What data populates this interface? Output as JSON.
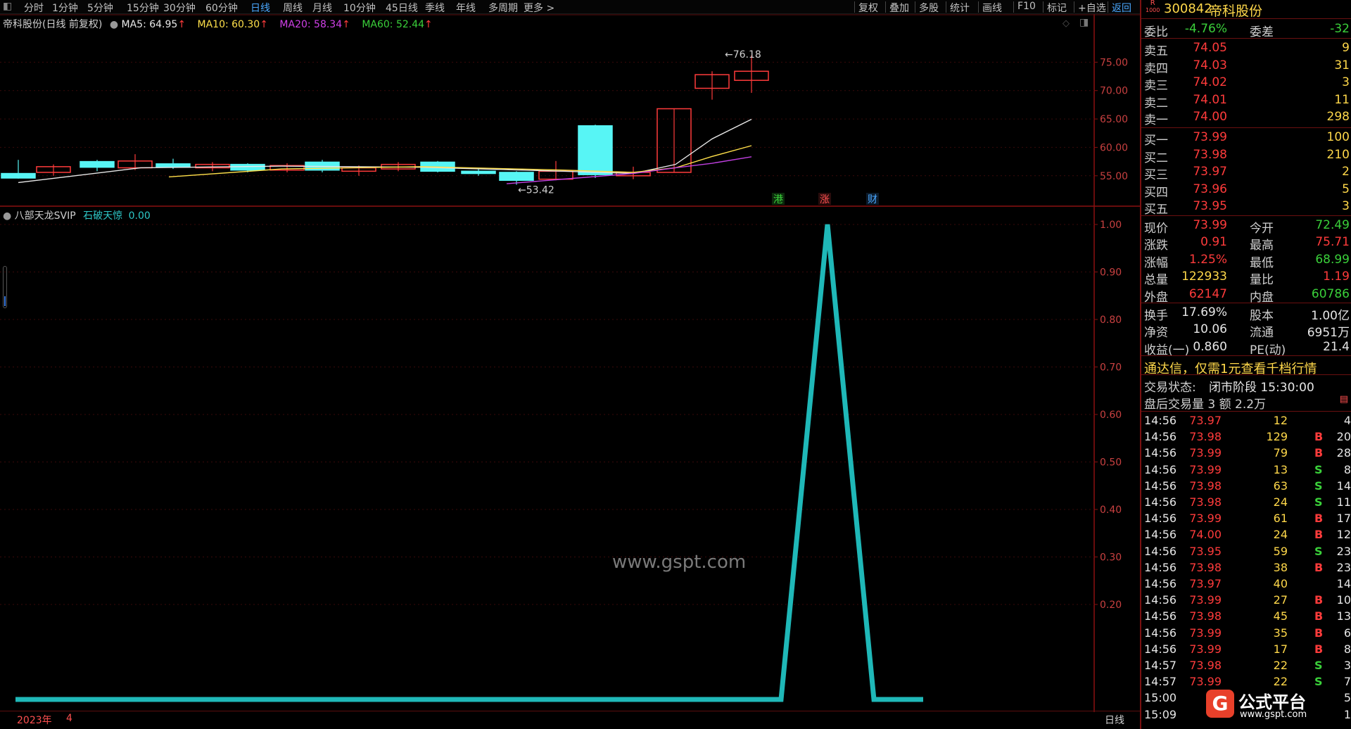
{
  "colors": {
    "up": "#ff3b3b",
    "down": "#57f5f5",
    "ma5": "#e8e8e8",
    "ma10": "#ffe04a",
    "ma20": "#c040e0",
    "ma60": "#3ad03a",
    "indicator": "#1fb8b8",
    "panel_border": "#7a1010"
  },
  "toolbar": {
    "left_icon": "window-icon",
    "periods": [
      "分时",
      "1分钟",
      "5分钟",
      "15分钟",
      "30分钟",
      "60分钟",
      "日线",
      "周线",
      "月线",
      "10分钟",
      "45日线",
      "季线",
      "年线",
      "多周期",
      "更多 >"
    ],
    "active_period": "日线",
    "right_tools": [
      "复权",
      "叠加",
      "多股",
      "统计",
      "画线",
      "F10",
      "标记",
      "+自选",
      "返回"
    ]
  },
  "main_chart": {
    "title": "帝科股份(日线 前复权)",
    "ma_labels": [
      {
        "text": "MA5: 64.95",
        "arrow": "↑"
      },
      {
        "text": "MA10: 60.30",
        "arrow": "↑"
      },
      {
        "text": "MA20: 58.34",
        "arrow": "↑"
      },
      {
        "text": "MA60: 52.44",
        "arrow": "↑"
      }
    ],
    "y_ticks": [
      "75.00",
      "70.00",
      "65.00",
      "60.00",
      "55.00"
    ],
    "high_marker": "76.18",
    "low_marker": "53.42",
    "event_tags": [
      "港",
      "涨",
      "财"
    ]
  },
  "sub_chart": {
    "title": "八部天龙SVIP",
    "series_label": "石破天惊",
    "series_value": "0.00",
    "y_ticks": [
      "1.00",
      "0.90",
      "0.80",
      "0.70",
      "0.60",
      "0.50",
      "0.40",
      "0.30",
      "0.20"
    ]
  },
  "chart_data": {
    "type": "line",
    "title": "八部天龙SVIP",
    "series": [
      {
        "name": "石破天惊",
        "values": [
          0,
          0,
          0,
          0,
          0,
          0,
          0,
          0,
          0,
          0,
          0,
          0,
          0,
          0,
          0,
          0,
          0,
          0,
          0,
          0,
          0,
          0,
          0,
          1,
          0,
          0
        ]
      }
    ],
    "ylim": [
      0,
      1.05
    ]
  },
  "watermark": "www.gspt.com",
  "bottom": {
    "year": "2023年",
    "month": "4",
    "period": "日线"
  },
  "quote": {
    "code": "300842",
    "name": "帝科股份",
    "badge_top": "R",
    "badge_bottom": "1000",
    "webi_label": "委比",
    "webi": "-4.76%",
    "wecha_label": "委差",
    "wecha": "-32",
    "asks": [
      {
        "label": "卖五",
        "price": "74.05",
        "vol": "9"
      },
      {
        "label": "卖四",
        "price": "74.03",
        "vol": "31"
      },
      {
        "label": "卖三",
        "price": "74.02",
        "vol": "3"
      },
      {
        "label": "卖二",
        "price": "74.01",
        "vol": "11"
      },
      {
        "label": "卖一",
        "price": "74.00",
        "vol": "298"
      }
    ],
    "bids": [
      {
        "label": "买一",
        "price": "73.99",
        "vol": "100"
      },
      {
        "label": "买二",
        "price": "73.98",
        "vol": "210"
      },
      {
        "label": "买三",
        "price": "73.97",
        "vol": "2"
      },
      {
        "label": "买四",
        "price": "73.96",
        "vol": "5"
      },
      {
        "label": "买五",
        "price": "73.95",
        "vol": "3"
      }
    ],
    "stats1": [
      {
        "l1": "现价",
        "v1": "73.99",
        "c1": "red",
        "l2": "今开",
        "v2": "72.49",
        "c2": "green"
      },
      {
        "l1": "涨跌",
        "v1": "0.91",
        "c1": "red",
        "l2": "最高",
        "v2": "75.71",
        "c2": "red"
      },
      {
        "l1": "涨幅",
        "v1": "1.25%",
        "c1": "red",
        "l2": "最低",
        "v2": "68.99",
        "c2": "green"
      },
      {
        "l1": "总量",
        "v1": "122933",
        "c1": "yel",
        "l2": "量比",
        "v2": "1.19",
        "c2": "red"
      },
      {
        "l1": "外盘",
        "v1": "62147",
        "c1": "red",
        "l2": "内盘",
        "v2": "60786",
        "c2": "green"
      }
    ],
    "stats2": [
      {
        "l1": "换手",
        "v1": "17.69%",
        "l2": "股本",
        "v2": "1.00亿"
      },
      {
        "l1": "净资",
        "v1": "10.06",
        "l2": "流通",
        "v2": "6951万"
      },
      {
        "l1": "收益(一)",
        "v1": "0.860",
        "l2": "PE(动)",
        "v2": "21.4"
      }
    ],
    "promo": "通达信，仅需1元查看千档行情",
    "status_label": "交易状态:",
    "status_value": "闭市阶段 15:30:00",
    "after_hours": "盘后交易量 3 额 2.2万",
    "ticks": [
      {
        "t": "14:56",
        "p": "73.97",
        "v": "12",
        "d": "",
        "n": "4"
      },
      {
        "t": "14:56",
        "p": "73.98",
        "v": "129",
        "d": "B",
        "n": "20"
      },
      {
        "t": "14:56",
        "p": "73.99",
        "v": "79",
        "d": "B",
        "n": "28"
      },
      {
        "t": "14:56",
        "p": "73.99",
        "v": "13",
        "d": "S",
        "n": "8"
      },
      {
        "t": "14:56",
        "p": "73.98",
        "v": "63",
        "d": "S",
        "n": "14"
      },
      {
        "t": "14:56",
        "p": "73.98",
        "v": "24",
        "d": "S",
        "n": "11"
      },
      {
        "t": "14:56",
        "p": "73.99",
        "v": "61",
        "d": "B",
        "n": "17"
      },
      {
        "t": "14:56",
        "p": "74.00",
        "v": "24",
        "d": "B",
        "n": "12"
      },
      {
        "t": "14:56",
        "p": "73.95",
        "v": "59",
        "d": "S",
        "n": "23"
      },
      {
        "t": "14:56",
        "p": "73.98",
        "v": "38",
        "d": "B",
        "n": "23"
      },
      {
        "t": "14:56",
        "p": "73.97",
        "v": "40",
        "d": "",
        "n": "14"
      },
      {
        "t": "14:56",
        "p": "73.99",
        "v": "27",
        "d": "B",
        "n": "10"
      },
      {
        "t": "14:56",
        "p": "73.98",
        "v": "45",
        "d": "B",
        "n": "13"
      },
      {
        "t": "14:56",
        "p": "73.99",
        "v": "35",
        "d": "B",
        "n": "6"
      },
      {
        "t": "14:56",
        "p": "73.99",
        "v": "17",
        "d": "B",
        "n": "8"
      },
      {
        "t": "14:57",
        "p": "73.98",
        "v": "22",
        "d": "S",
        "n": "3"
      },
      {
        "t": "14:57",
        "p": "73.99",
        "v": "22",
        "d": "S",
        "n": "7"
      },
      {
        "t": "15:00",
        "p": "",
        "v": "",
        "d": "",
        "n": "5"
      },
      {
        "t": "15:09",
        "p": "",
        "v": "",
        "d": "",
        "n": "1"
      }
    ],
    "logo_text": "公式平台",
    "logo_url": "www.gspt.com"
  }
}
